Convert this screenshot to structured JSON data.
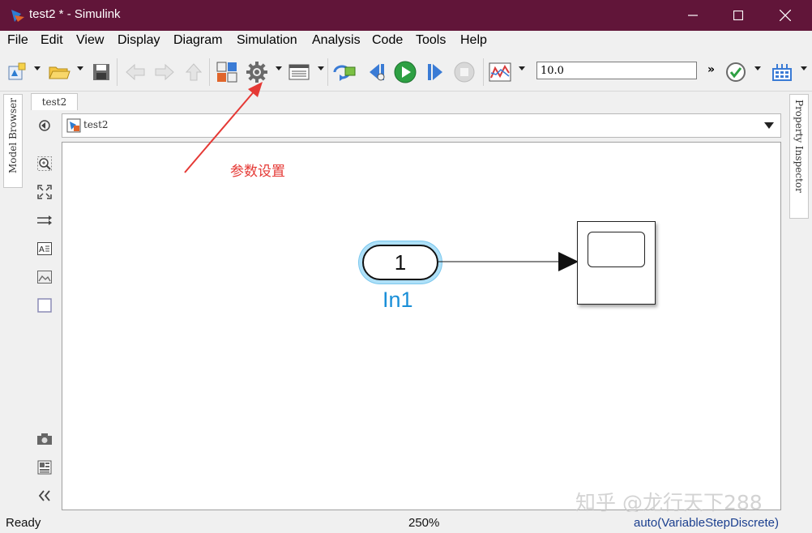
{
  "window": {
    "title": "test2 * - Simulink",
    "title_bar_color": "#611539"
  },
  "menu": [
    "File",
    "Edit",
    "View",
    "Display",
    "Diagram",
    "Simulation",
    "Analysis",
    "Code",
    "Tools",
    "Help"
  ],
  "toolbar": {
    "stop_time": "10.0",
    "icons": [
      "new-model-icon",
      "open-icon",
      "save-icon",
      "back-icon",
      "forward-icon",
      "up-icon",
      "library-browser-icon",
      "model-settings-gear-icon",
      "model-explorer-icon",
      "update-diagram-icon",
      "step-back-icon",
      "run-icon",
      "step-forward-icon",
      "stop-icon",
      "data-inspector-icon",
      "more-icon",
      "check-icon",
      "block-grid-icon"
    ]
  },
  "left_panel": {
    "model_browser_label": "Model Browser"
  },
  "right_panel": {
    "property_inspector_label": "Property Inspector"
  },
  "editor": {
    "tab_label": "test2",
    "breadcrumb": "test2"
  },
  "annotation": {
    "label": "参数设置",
    "color": "#e53935"
  },
  "diagram": {
    "inport_number": "1",
    "inport_name": "In1",
    "inport_color": "#1a8fd8"
  },
  "watermark": "知乎 @龙行天下288",
  "status": {
    "left": "Ready",
    "zoom": "250%",
    "solver": "auto(VariableStepDiscrete)"
  }
}
